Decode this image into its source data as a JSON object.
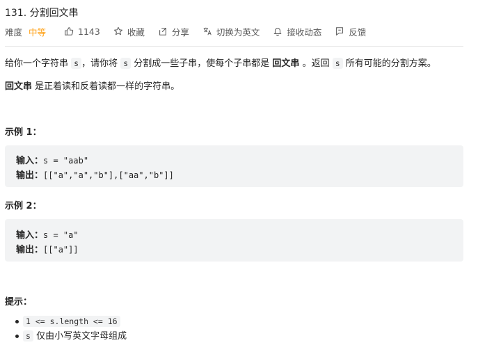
{
  "problem": {
    "title": "131. 分割回文串",
    "difficulty_label": "难度",
    "difficulty_value": "中等",
    "likes": "1143",
    "collect_label": "收藏",
    "share_label": "分享",
    "switch_lang_label": "切换为英文",
    "notify_label": "接收动态",
    "feedback_label": "反馈"
  },
  "description": {
    "p1_a": "给你一个字符串 ",
    "p1_code1": "s",
    "p1_b": "，请你将 ",
    "p1_code2": "s",
    "p1_c": " 分割成一些子串，使每个子串都是 ",
    "p1_bold": "回文串",
    "p1_d": " 。返回 ",
    "p1_code3": "s",
    "p1_e": " 所有可能的分割方案。",
    "p2_bold": "回文串",
    "p2_rest": " 是正着读和反着读都一样的字符串。"
  },
  "examples": [
    {
      "heading": "示例 1：",
      "input_label": "输入：",
      "input_value": "s = \"aab\"",
      "output_label": "输出：",
      "output_value": "[[\"a\",\"a\",\"b\"],[\"aa\",\"b\"]]"
    },
    {
      "heading": "示例 2：",
      "input_label": "输入：",
      "input_value": "s = \"a\"",
      "output_label": "输出：",
      "output_value": "[[\"a\"]]"
    }
  ],
  "constraints": {
    "heading": "提示：",
    "item1_code": "1 <= s.length <= 16",
    "item2_code": "s",
    "item2_text": " 仅由小写英文字母组成"
  },
  "colors": {
    "difficulty_medium": "#ffa116",
    "code_bg": "#f2f3f4",
    "text": "#262626",
    "muted": "#595959"
  }
}
